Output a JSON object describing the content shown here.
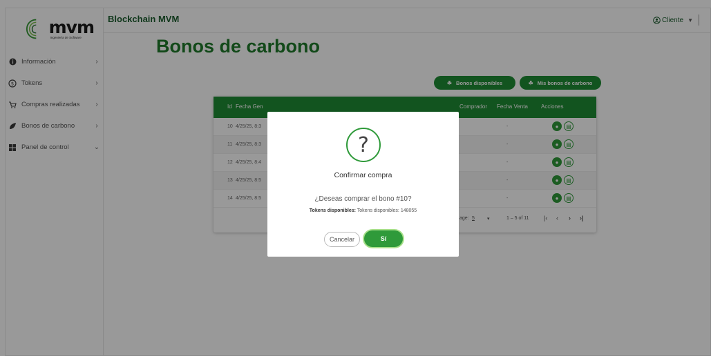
{
  "topbar": {
    "app_title": "Blockchain MVM",
    "user_label": "Cliente"
  },
  "logo": {
    "word": "mvm",
    "sub": "Ingeniería de Software"
  },
  "sidebar": {
    "items": [
      {
        "label": "Información",
        "icon": "info-icon",
        "chev": "›"
      },
      {
        "label": "Tokens",
        "icon": "token-icon",
        "chev": "›"
      },
      {
        "label": "Compras realizadas",
        "icon": "cart-icon",
        "chev": "›"
      },
      {
        "label": "Bonos de carbono",
        "icon": "leaf-icon",
        "chev": "›"
      },
      {
        "label": "Panel de control",
        "icon": "dashboard-icon",
        "chev": "⌄"
      }
    ]
  },
  "main": {
    "title": "Bonos de carbono",
    "btn_available": "Bonos disponibles",
    "btn_mine": "Mis bonos de carbono"
  },
  "table": {
    "headers": {
      "id": "Id",
      "fecha_gen": "Fecha Gen",
      "comprador": "Comprador",
      "fecha_venta": "Fecha Venta",
      "acciones": "Acciones"
    },
    "rows": [
      {
        "id": "10",
        "fecha": "4/25/25, 8:3",
        "venta": "-"
      },
      {
        "id": "11",
        "fecha": "4/25/25, 8:3",
        "venta": "-"
      },
      {
        "id": "12",
        "fecha": "4/25/25, 8:4",
        "venta": "-"
      },
      {
        "id": "13",
        "fecha": "4/25/25, 8:5",
        "venta": "-"
      },
      {
        "id": "14",
        "fecha": "4/25/25, 8:5",
        "venta": "-"
      }
    ],
    "pager": {
      "per_page_label": "age:",
      "per_page": "5",
      "range": "1 – 5 of 11"
    }
  },
  "modal": {
    "icon_glyph": "?",
    "title": "Confirmar compra",
    "message": "¿Deseas comprar el bono #10?",
    "tokens_label": "Tokens disponibles:",
    "tokens_value": "Tokens disponibles: 148055",
    "cancel": "Cancelar",
    "confirm": "Sí"
  },
  "colors": {
    "brand_green": "#1f8c34",
    "title_green": "#1f7a2b",
    "overlay": "rgba(0,0,0,0.4)"
  }
}
